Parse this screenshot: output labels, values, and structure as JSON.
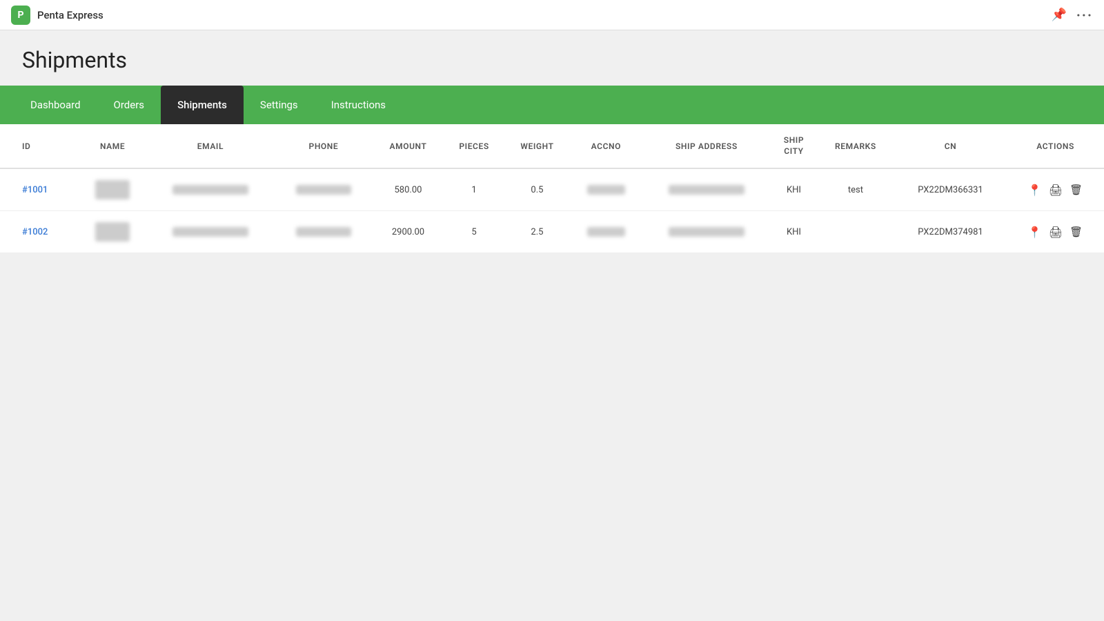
{
  "app": {
    "icon_letter": "P",
    "name": "Penta Express"
  },
  "topbar": {
    "pin_icon": "📌",
    "more_icon": "•••"
  },
  "page": {
    "title": "Shipments"
  },
  "navbar": {
    "items": [
      {
        "label": "Dashboard",
        "active": false
      },
      {
        "label": "Orders",
        "active": false
      },
      {
        "label": "Shipments",
        "active": true
      },
      {
        "label": "Settings",
        "active": false
      },
      {
        "label": "Instructions",
        "active": false
      }
    ]
  },
  "table": {
    "columns": [
      "ID",
      "NAME",
      "EMAIL",
      "PHONE",
      "AMOUNT",
      "PIECES",
      "WEIGHT",
      "ACCNO",
      "SHIP ADDRESS",
      "SHIP CITY",
      "REMARKS",
      "CN",
      "ACTIONS"
    ],
    "rows": [
      {
        "id": "#1001",
        "name": "blurred",
        "email": "blurred",
        "phone": "blurred",
        "amount": "580.00",
        "pieces": "1",
        "weight": "0.5",
        "accno": "blurred",
        "ship_address": "blurred",
        "ship_city": "KHI",
        "remarks": "test",
        "cn": "PX22DM366331"
      },
      {
        "id": "#1002",
        "name": "blurred",
        "email": "blurred",
        "phone": "blurred",
        "amount": "2900.00",
        "pieces": "5",
        "weight": "2.5",
        "accno": "blurred",
        "ship_address": "blurred",
        "ship_city": "KHI",
        "remarks": "",
        "cn": "PX22DM374981"
      }
    ]
  }
}
